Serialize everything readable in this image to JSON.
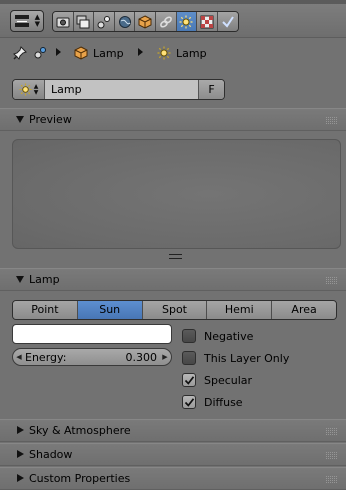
{
  "header": {
    "context_tabs": [
      {
        "icon": "render-icon",
        "active": false
      },
      {
        "icon": "render-layers-icon",
        "active": false
      },
      {
        "icon": "scene-icon",
        "active": false
      },
      {
        "icon": "world-icon",
        "active": false
      },
      {
        "icon": "object-icon",
        "active": false
      },
      {
        "icon": "constraints-icon",
        "active": false
      },
      {
        "icon": "lamp-data-icon",
        "active": true
      },
      {
        "icon": "texture-icon",
        "active": false
      },
      {
        "icon": "modifiers-icon",
        "active": false
      }
    ]
  },
  "breadcrumb": {
    "items": [
      {
        "icon": "pin-icon",
        "label": ""
      },
      {
        "icon": "object-data-icon",
        "label": ""
      },
      {
        "icon": "object-cube-icon",
        "label": "Lamp"
      },
      {
        "icon": "lamp-sun-icon",
        "label": "Lamp"
      }
    ]
  },
  "datablock": {
    "name": "Lamp",
    "fake_user": "F"
  },
  "panels": {
    "preview": {
      "title": "Preview",
      "expanded": true
    },
    "lamp": {
      "title": "Lamp",
      "expanded": true,
      "types": [
        "Point",
        "Sun",
        "Spot",
        "Hemi",
        "Area"
      ],
      "selected_type": "Sun",
      "color": "#ffffff",
      "energy_label": "Energy:",
      "energy_value": "0.300",
      "options": [
        {
          "label": "Negative",
          "checked": false
        },
        {
          "label": "This Layer Only",
          "checked": false
        },
        {
          "label": "Specular",
          "checked": true
        },
        {
          "label": "Diffuse",
          "checked": true
        }
      ]
    },
    "sky": {
      "title": "Sky & Atmosphere",
      "expanded": false
    },
    "shadow": {
      "title": "Shadow",
      "expanded": false
    },
    "custom": {
      "title": "Custom Properties",
      "expanded": false
    }
  }
}
